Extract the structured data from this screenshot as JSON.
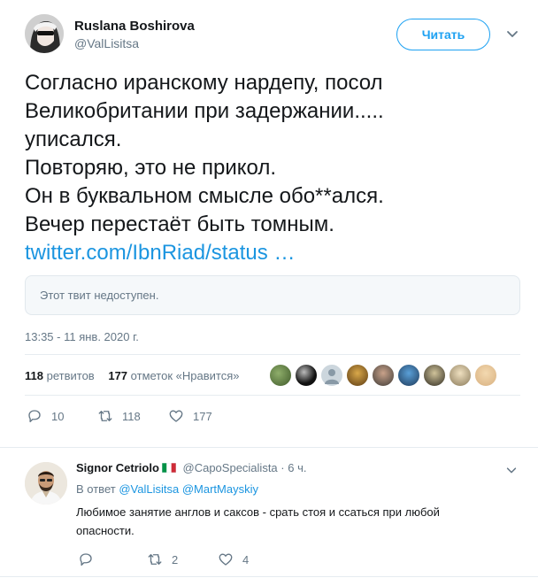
{
  "tweet": {
    "author": {
      "name": "Ruslana Boshirova",
      "handle": "@ValLisitsa"
    },
    "follow_label": "Читать",
    "text_lines": [
      "Согласно иранскому нардепу, посол",
      "Великобритании при задержании.....",
      "уписался.",
      "Повторяю, это не прикол.",
      "Он в буквальном смысле обо**ался.",
      "Вечер перестаёт быть томным."
    ],
    "link_text": "twitter.com/IbnRiad/status …",
    "quote_unavailable": "Этот твит недоступен.",
    "timestamp": "13:35 - 11 янв. 2020 г.",
    "stats": {
      "retweets_count": "118",
      "retweets_label": "ретвитов",
      "likes_count": "177",
      "likes_label": "отметок «Нравится»"
    },
    "actions": {
      "replies": "10",
      "retweets": "118",
      "likes": "177"
    }
  },
  "reply": {
    "name": "Signor Cetriolo",
    "handle": "@CapoSpecialista",
    "separator": "·",
    "time": "6 ч.",
    "reply_to_prefix": "В ответ",
    "mentions": [
      "@ValLisitsa",
      "@MartMayskiy"
    ],
    "text": "Любимое занятие англов и саксов - срать стоя и ссаться при любой опасности.",
    "actions": {
      "replies": "",
      "retweets": "2",
      "likes": "4"
    }
  },
  "colors": {
    "accent": "#1da1f2",
    "link": "#1b95e0",
    "muted": "#657786",
    "text": "#14171a",
    "border": "#e6ecf0"
  },
  "icons": [
    "caret-down-icon",
    "reply-icon",
    "retweet-icon",
    "heart-icon",
    "italy-flag-icon"
  ]
}
